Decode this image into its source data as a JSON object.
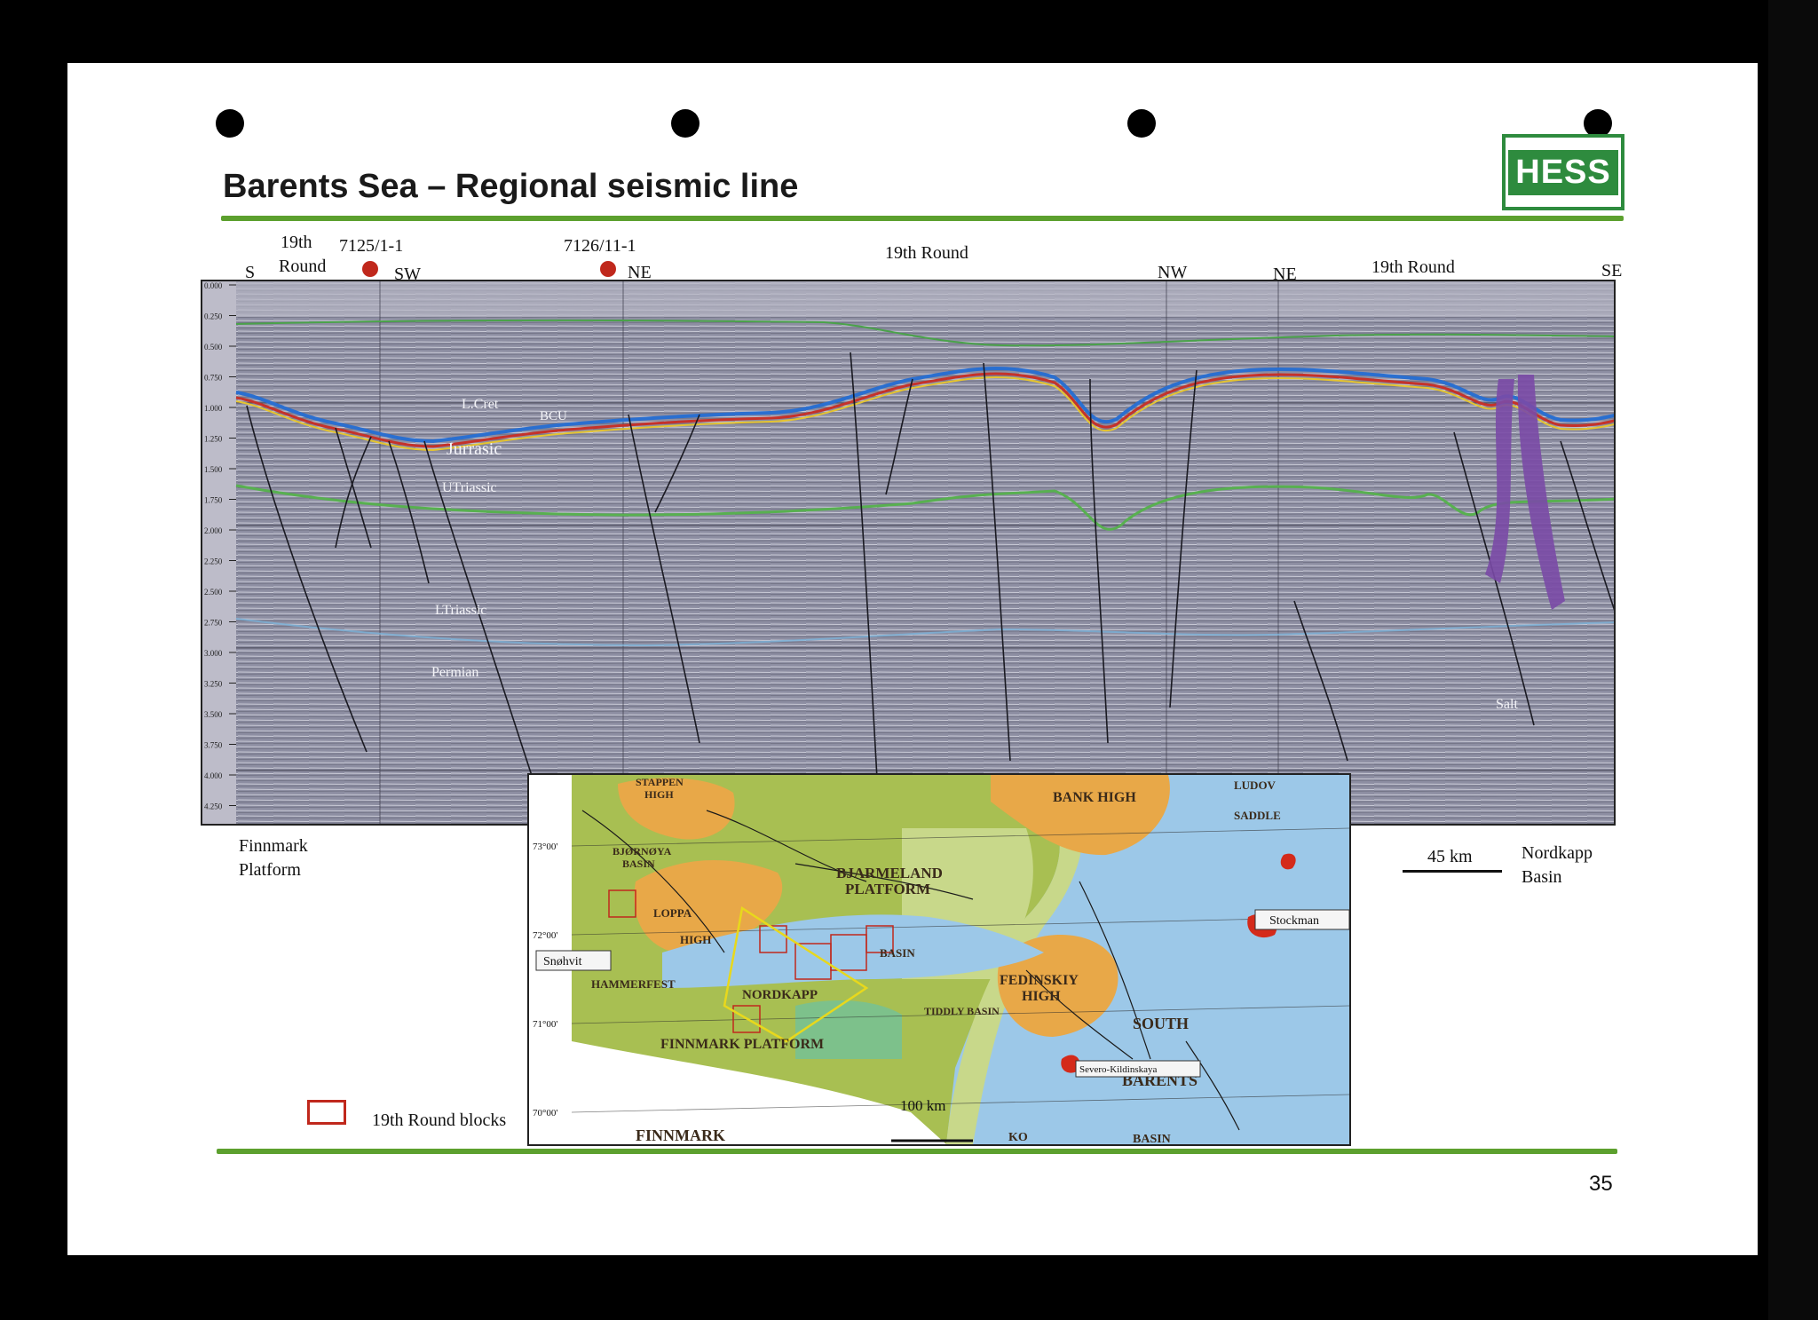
{
  "title": "Barents Sea – Regional seismic line",
  "logo": "HESS",
  "page_number": "35",
  "top_labels": {
    "s": "S",
    "round19_a_line1": "19th",
    "round19_a_line2": "Round",
    "well_a": "7125/1-1",
    "sw": "SW",
    "well_b": "7126/11-1",
    "ne_a": "NE",
    "round19_b": "19th Round",
    "nw": "NW",
    "ne_b": "NE",
    "round19_c": "19th Round",
    "se": "SE"
  },
  "time_axis": [
    "0.000",
    "0.250",
    "0.500",
    "0.750",
    "1.000",
    "1.250",
    "1.500",
    "1.750",
    "2.000",
    "2.250",
    "2.500",
    "2.750",
    "3.000",
    "3.250",
    "3.500",
    "3.750",
    "4.000",
    "4.250"
  ],
  "horizons": {
    "l_cret": "L.Cret",
    "bcu": "BCU",
    "jurassic": "Jurrasic",
    "u_triassic": "UTriassic",
    "l_triassic": "LTriassic",
    "permian": "Permian",
    "salt": "Salt"
  },
  "bottom_labels": {
    "finnmark_line1": "Finnmark",
    "finnmark_line2": "Platform",
    "nordkapp_line1": "Nordkapp",
    "nordkapp_line2": "Basin",
    "scale": "45 km"
  },
  "legend": {
    "label": "19th Round blocks"
  },
  "map": {
    "lat_labels": [
      "73°00'",
      "72°00'",
      "71°00'",
      "70°00'"
    ],
    "stappen_1": "STAPPEN",
    "stappen_2": "HIGH",
    "bank_high": "BANK HIGH",
    "ludov": "LUDOV",
    "saddle": "SADDLE",
    "bjornoya_1": "BJØRNØYA",
    "bjornoya_2": "BASIN",
    "bjarmeland_1": "BJARMELAND",
    "bjarmeland_2": "PLATFORM",
    "loppa_1": "LOPPA",
    "loppa_2": "HIGH",
    "hammerfest": "HAMMERFEST",
    "nordkapp": "NORDKAPP",
    "basin_label": "BASIN",
    "fedinskiy_1": "FEDINSKIY",
    "fedinskiy_2": "HIGH",
    "tiddly": "TIDDLY BASIN",
    "south": "SOUTH",
    "barents": "BARENTS",
    "basin_cut": "BASIN",
    "finnmark_platform": "FINNMARK PLATFORM",
    "finnmark": "FINNMARK",
    "ko": "KO",
    "snohvit": "Snøhvit",
    "stockman": "Stockman",
    "severo": "Severo-Kildinskaya",
    "scale": "100 km"
  },
  "colors": {
    "accent_green": "#5ca02e",
    "logo_green": "#2e8b3e",
    "well_red": "#c0281c",
    "round_yellow": "#e8d81c",
    "seismic_gray": "#8e8ea0",
    "map_sea": "#9cc8e8",
    "map_platform": "#a8bf52",
    "map_high": "#e8a848"
  }
}
